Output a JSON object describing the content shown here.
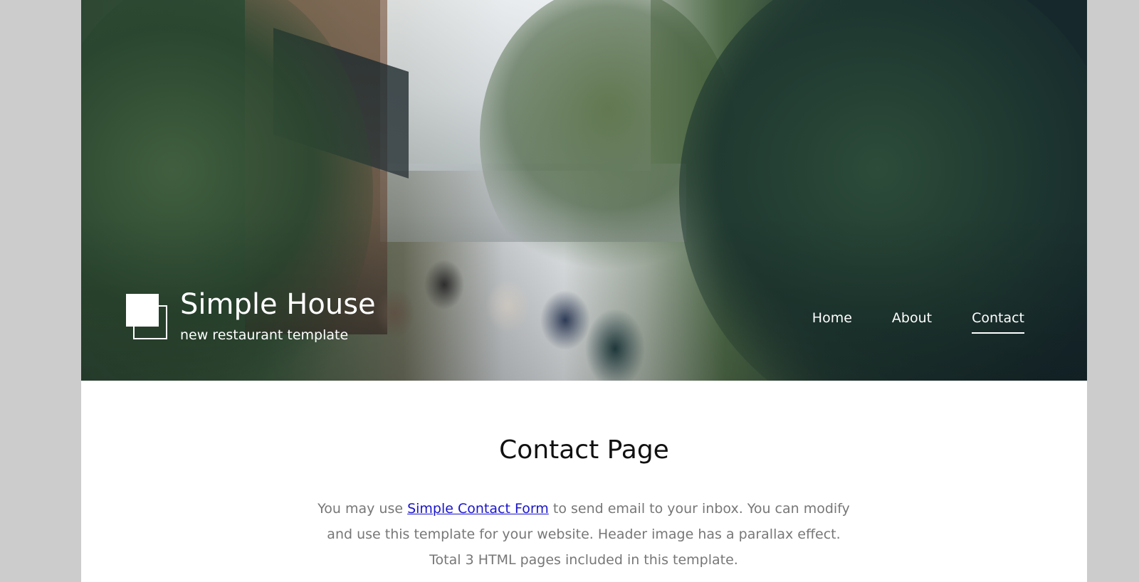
{
  "brand": {
    "title": "Simple House",
    "tagline": "new restaurant template",
    "logo_icon": "overlapping-squares-icon"
  },
  "nav": {
    "items": [
      {
        "label": "Home",
        "active": false
      },
      {
        "label": "About",
        "active": false
      },
      {
        "label": "Contact",
        "active": true
      }
    ]
  },
  "hero": {
    "image_description": "street cafe with people dining under trees"
  },
  "main": {
    "title": "Contact Page",
    "intro": {
      "before_link": "You may use ",
      "link_text": "Simple Contact Form",
      "after_link_line1": " to send email to your inbox. You can modify",
      "line2": "and use this template for your website. Header image has a parallax effect.",
      "line3": "Total 3 HTML pages included in this template."
    }
  },
  "colors": {
    "page_background": "#cccccc",
    "content_background": "#ffffff",
    "text_muted": "#777777",
    "link": "#1a15c9",
    "hero_text": "#ffffff"
  }
}
